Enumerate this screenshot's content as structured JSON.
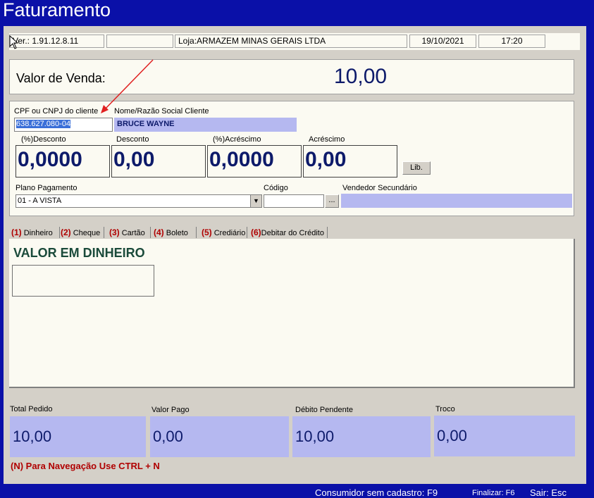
{
  "title": "Faturamento",
  "status": {
    "version": "Ver.: 1.91.12.8.11",
    "store": "Loja:ARMAZEM MINAS GERAIS LTDA",
    "date": "19/10/2021",
    "time": "17:20"
  },
  "sale": {
    "label": "Valor de Venda:",
    "value": "10,00"
  },
  "client": {
    "cpf_label": "CPF ou CNPJ do cliente",
    "cpf_value": "638.627.080-04",
    "name_label": "Nome/Razão Social Cliente",
    "name_value": "BRUCE WAYNE"
  },
  "discounts": {
    "pct_discount_label": "(%)Desconto",
    "pct_discount_value": "0,0000",
    "discount_label": "Desconto",
    "discount_value": "0,00",
    "pct_increase_label": "(%)Acréscimo",
    "pct_increase_value": "0,0000",
    "increase_label": "Acréscimo",
    "increase_value": "0,00",
    "lib_button": "Lib."
  },
  "payment": {
    "plan_label": "Plano Pagamento",
    "plan_value": "01 - A VISTA",
    "code_label": "Código",
    "code_value": "",
    "browse_button": "...",
    "seller_label": "Vendedor Secundário",
    "seller_value": ""
  },
  "tabs": [
    {
      "num": "(1)",
      "label": " Dinheiro"
    },
    {
      "num": "(2)",
      "label": " Cheque"
    },
    {
      "num": "(3)",
      "label": " Cartão"
    },
    {
      "num": "(4)",
      "label": "  Boleto"
    },
    {
      "num": "(5)",
      "label": " Crediário"
    },
    {
      "num": "(6)",
      "label": "Debitar do Crédito"
    }
  ],
  "cash": {
    "title": "VALOR EM DINHEIRO",
    "value": ""
  },
  "totals": {
    "total_label": "Total Pedido",
    "total_value": "10,00",
    "paid_label": "Valor Pago",
    "paid_value": "0,00",
    "pending_label": "Débito Pendente",
    "pending_value": "10,00",
    "change_label": "Troco",
    "change_value": "0,00"
  },
  "nav_hint": "(N) Para Navegação Use CTRL + N",
  "footer": {
    "no_register": "Consumidor sem cadastro: F9",
    "finish": "Finalizar: F6",
    "exit": "Sair: Esc"
  },
  "colors": {
    "accent": "#b00000",
    "value_blue": "#0d1a6a",
    "field_blue": "#b5b8f0",
    "frame": "#0a10a8",
    "cash_title": "#1a4a3a"
  }
}
